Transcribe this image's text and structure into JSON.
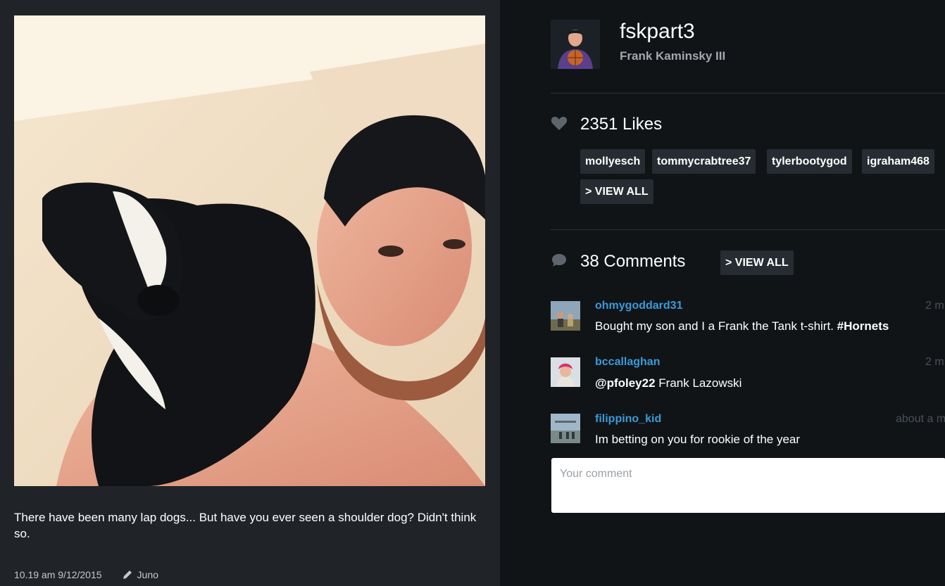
{
  "post": {
    "caption": "There have been many lap dogs... But have you ever seen a shoulder dog? Didn't think so.",
    "timestamp": "10.19 am 9/12/2015",
    "filter": "Juno"
  },
  "profile": {
    "username": "fskpart3",
    "full_name": "Frank Kaminsky III"
  },
  "likes": {
    "label": "2351 Likes",
    "users": [
      "mollyesch",
      "tommycrabtree37",
      "tylerbootygod",
      "igraham468"
    ],
    "view_all_label": "> VIEW ALL"
  },
  "comments": {
    "label": "38 Comments",
    "view_all_label": "> VIEW ALL",
    "items": [
      {
        "user": "ohmygoddard31",
        "time": "2 m",
        "text": "Bought my son and I a Frank the Tank t-shirt.",
        "tag": "#Hornets"
      },
      {
        "user": "bccallaghan",
        "time": "2 m",
        "mention": "@pfoley22",
        "text": "Frank Lazowski"
      },
      {
        "user": "filippino_kid",
        "time": "about a m",
        "text": "Im betting on you for rookie of the year"
      }
    ],
    "input_placeholder": "Your comment"
  },
  "colors": {
    "left_panel": "#202429",
    "right_panel": "#111417",
    "link_blue": "#3a9ad8",
    "chip_bg": "#272c32"
  }
}
